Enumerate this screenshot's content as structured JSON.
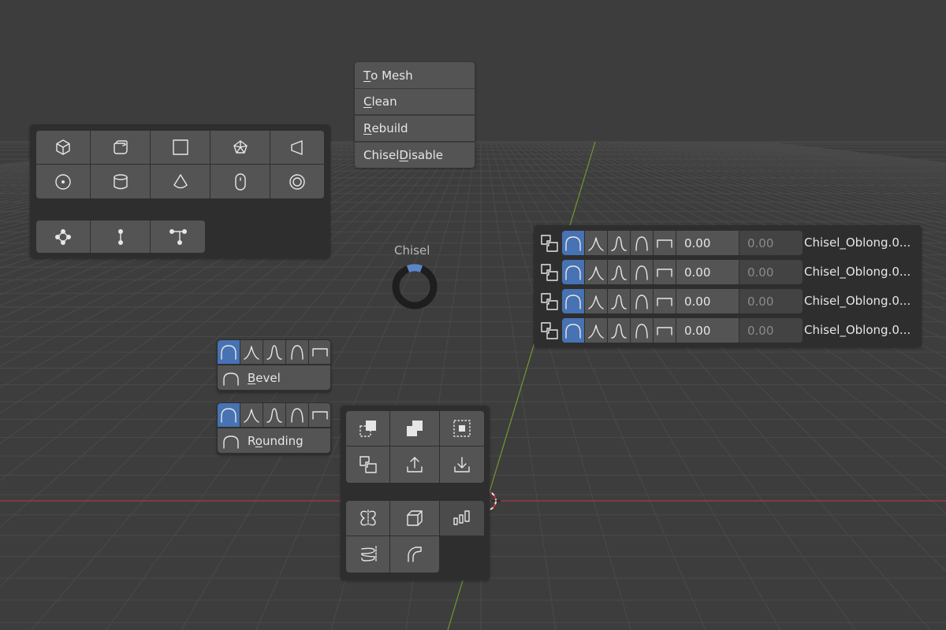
{
  "context_menu": {
    "items": [
      {
        "pre": "",
        "key": "T",
        "post": "o Mesh"
      },
      {
        "pre": "",
        "key": "C",
        "post": "lean"
      },
      {
        "pre": "",
        "key": "R",
        "post": "ebuild"
      },
      {
        "pre": "Chisel ",
        "key": "D",
        "post": "isable"
      }
    ]
  },
  "pie": {
    "title": "Chisel"
  },
  "shape_panel": {
    "row1_icons": [
      "cube-icon",
      "rounded-cube-icon",
      "plane-icon",
      "prism-icon",
      "wedge-icon"
    ],
    "row2_icons": [
      "circle-icon",
      "cylinder-icon",
      "cone-drop-icon",
      "oblong-icon",
      "ring-icon"
    ],
    "row3_icons": [
      "vertices-icon",
      "edge-icon",
      "edge-branch-icon"
    ]
  },
  "profile_bevel": {
    "label_pre": "",
    "label_key": "B",
    "label_post": "evel"
  },
  "profile_rounding": {
    "label_pre": "R",
    "label_key": "o",
    "label_post": "unding"
  },
  "chisel_list": {
    "rows": [
      {
        "value1": "0.00",
        "value2": "0.00",
        "name": "Chisel_Oblong.0..."
      },
      {
        "value1": "0.00",
        "value2": "0.00",
        "name": "Chisel_Oblong.0..."
      },
      {
        "value1": "0.00",
        "value2": "0.00",
        "name": "Chisel_Oblong.0..."
      },
      {
        "value1": "0.00",
        "value2": "0.00",
        "name": "Chisel_Oblong.0..."
      }
    ]
  },
  "ops_panel": {
    "top_icons": [
      "difference-icon",
      "union-icon",
      "intersect-icon",
      "slice-icon",
      "export-icon",
      "import-icon"
    ],
    "bottom_icons": [
      "mirror-icon",
      "solidify-icon",
      "array-icon",
      "screw-icon",
      "curve-icon"
    ]
  },
  "colors": {
    "accent": "#4772b3",
    "panel": "#2e2e2e",
    "button": "#545454",
    "viewport": "#3d3d3d"
  }
}
